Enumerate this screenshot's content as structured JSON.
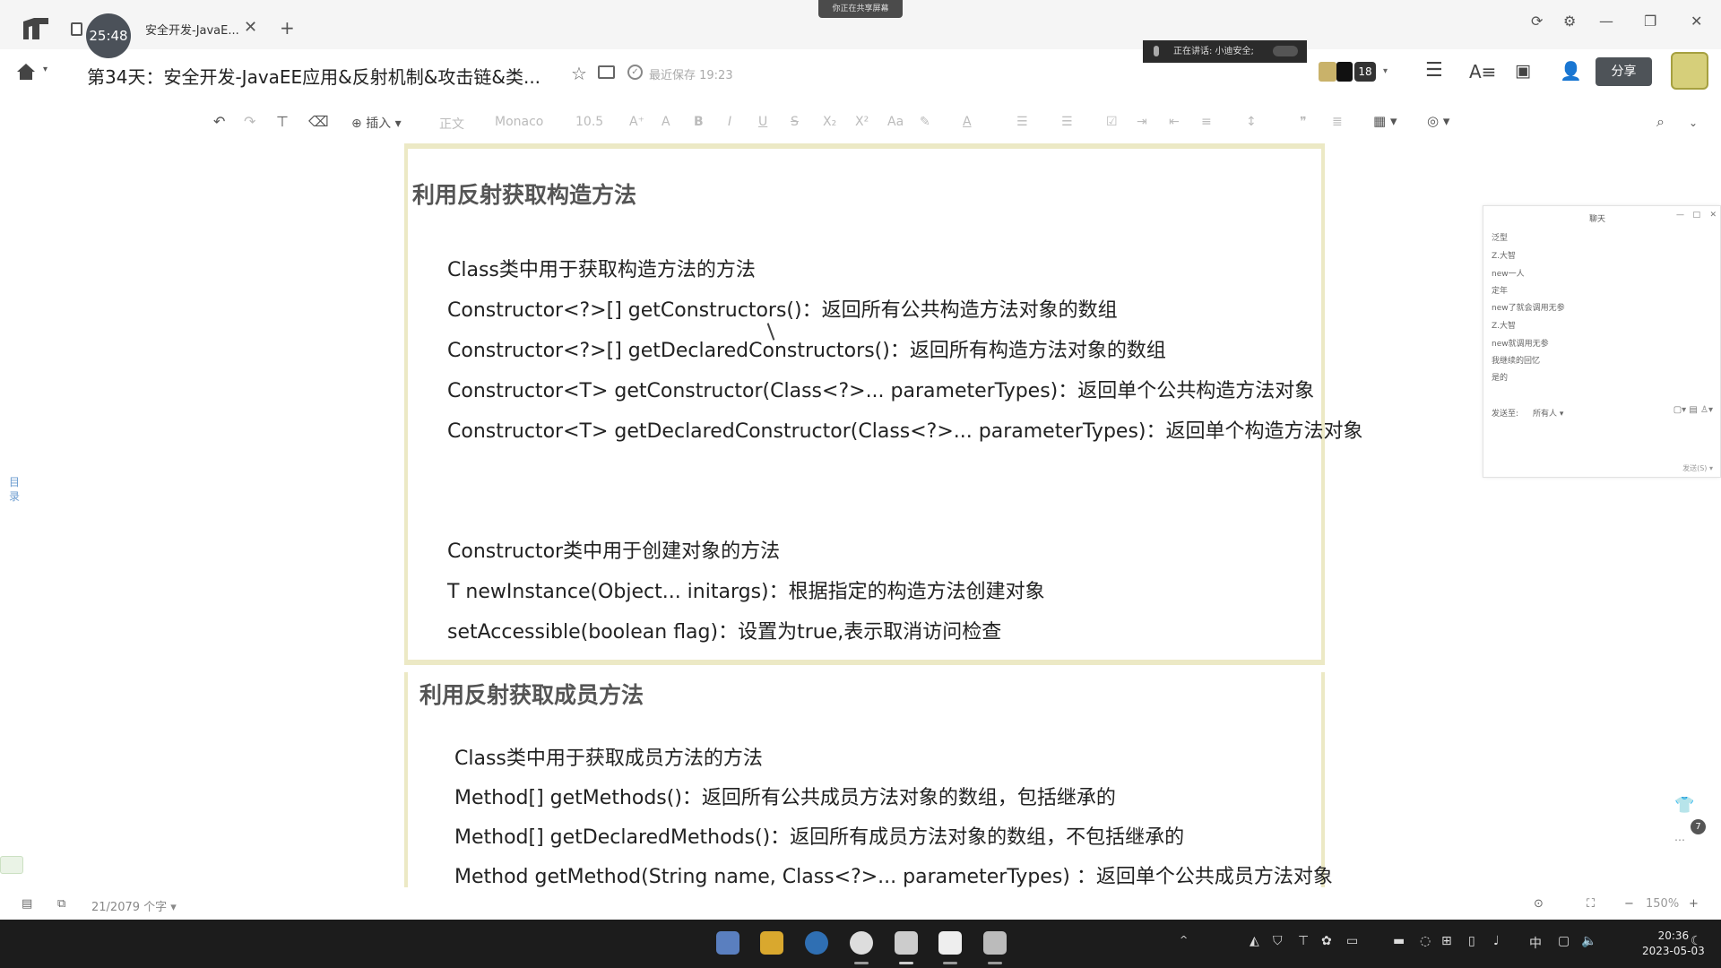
{
  "titlebar": {
    "timer": "25:48",
    "tab_title": "安全开发-JavaE...",
    "tab_close": "✕",
    "tab_add": "+",
    "share_banner": "你正在共享屏幕",
    "win_controls": [
      "⟳",
      "⚙",
      "—",
      "❐",
      "✕"
    ]
  },
  "header": {
    "doc_title": "第34天：安全开发-JavaEE应用&反射机制&攻击链&类...",
    "saved_status": "最近保存 19:23",
    "speaker": "正在讲话: 小迪安全;",
    "member_count": "18",
    "share_label": "分享"
  },
  "toolbar": {
    "insert_label": "插入",
    "style_label": "正文",
    "font_label": "Monaco",
    "size_label": "10.5"
  },
  "document": {
    "section1": {
      "heading": "利用反射获取构造方法",
      "sub_heading": "Class类中用于获取构造方法的方法",
      "lines": [
        "Constructor<?>[] getConstructors()：返回所有公共构造方法对象的数组",
        "Constructor<?>[] getDeclaredConstructors()：返回所有构造方法对象的数组",
        "Constructor<T> getConstructor(Class<?>... parameterTypes)：返回单个公共构造方法对象",
        "Constructor<T> getDeclaredConstructor(Class<?>... parameterTypes)：返回单个构造方法对象"
      ],
      "sub_heading2": "Constructor类中用于创建对象的方法",
      "lines2": [
        "T newInstance(Object... initargs)：根据指定的构造方法创建对象",
        "setAccessible(boolean flag)：设置为true,表示取消访问检查"
      ]
    },
    "section2": {
      "heading": "利用反射获取成员方法",
      "sub_heading": "Class类中用于获取成员方法的方法",
      "lines": [
        "Method[] getMethods()：返回所有公共成员方法对象的数组，包括继承的",
        "Method[] getDeclaredMethods()：返回所有成员方法对象的数组，不包括继承的",
        "Method getMethod(String name, Class<?>... parameterTypes) ：返回单个公共成员方法对象"
      ]
    }
  },
  "sidebar": {
    "toc_label": "目录"
  },
  "chat": {
    "title": "聊天",
    "messages": [
      "泛型",
      "Z.大智",
      "new一人",
      "定年",
      "new了就会调用无参",
      "Z.大智",
      "new就调用无参",
      "我继续的回忆",
      "是的"
    ],
    "send_to_label": "发送至:",
    "recipient": "所有人",
    "send_label": "发送(S)"
  },
  "float": {
    "badge": "7"
  },
  "statusbar": {
    "word_count": "21/2079 个字",
    "zoom": "150%"
  },
  "taskbar": {
    "ime": "中",
    "time": "20:36",
    "date": "2023-05-03"
  },
  "colors": {
    "block_border": "#ece9c5",
    "share_button": "#4e5358",
    "taskbar": "#1c1c1c"
  }
}
